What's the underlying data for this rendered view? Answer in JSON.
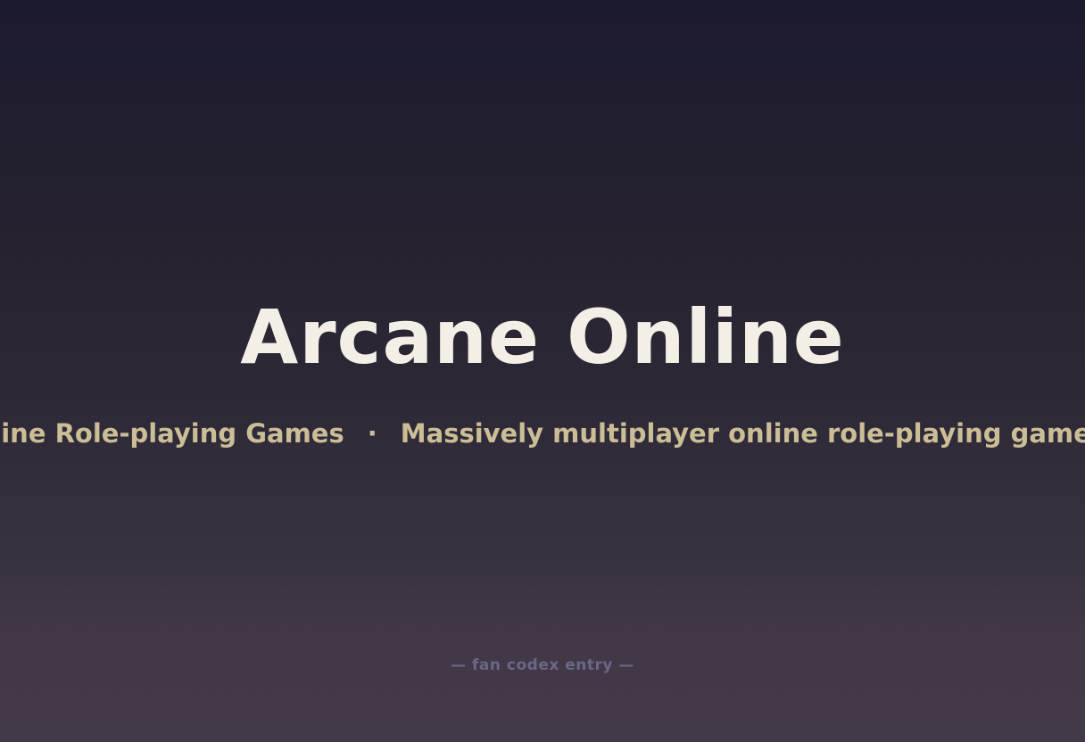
{
  "title": "Arcane Online",
  "ticker": {
    "phrase_1": "Massively Multiplayer Online Role-playing Games",
    "separator": "·",
    "phrase_2": "Massively multiplayer online role-playing games"
  },
  "footer": {
    "caption": "— fan codex entry —"
  },
  "colors": {
    "title": "#f4efe6",
    "ticker": "#cbbd96",
    "footer": "#6b6788",
    "background_top": "#1c1a2f",
    "background_bottom": "#433a48"
  }
}
